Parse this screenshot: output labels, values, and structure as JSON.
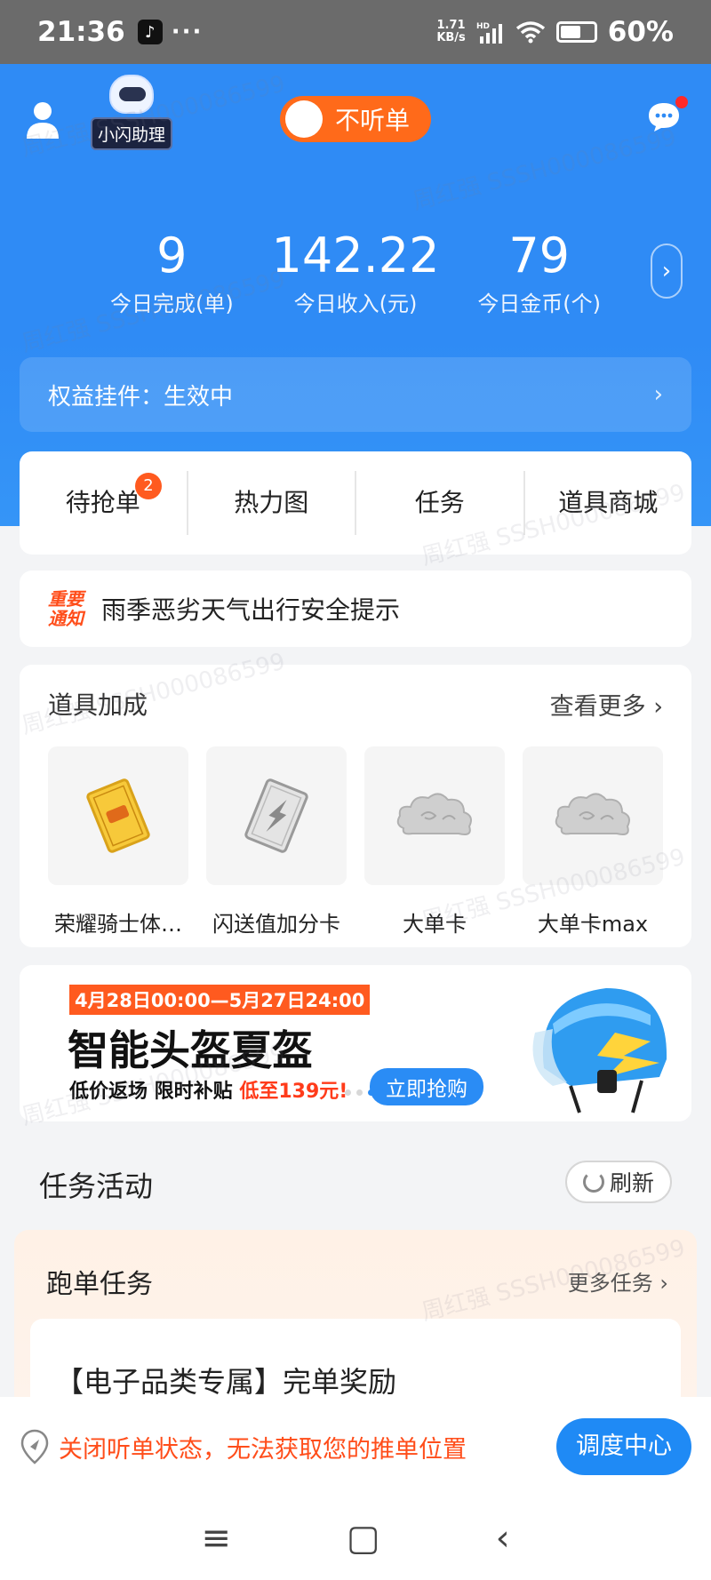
{
  "status_bar": {
    "time": "21:36",
    "dots": "···",
    "net_speed_top": "1.71",
    "net_speed_unit": "KB/s",
    "hd": "HD",
    "battery": "60%"
  },
  "header": {
    "assistant_label": "小闪助理",
    "listen_toggle_label": "不听单"
  },
  "stats": [
    {
      "value": "9",
      "label": "今日完成(单)"
    },
    {
      "value": "142.22",
      "label": "今日收入(元)"
    },
    {
      "value": "79",
      "label": "今日金币(个)"
    }
  ],
  "rights_bar": {
    "label": "权益挂件：生效中"
  },
  "nav": [
    {
      "label": "待抢单",
      "badge": "2"
    },
    {
      "label": "热力图"
    },
    {
      "label": "任务"
    },
    {
      "label": "道具商城"
    }
  ],
  "notice": {
    "tag_line1": "重要",
    "tag_line2": "通知",
    "text": "雨季恶劣天气出行安全提示"
  },
  "props": {
    "title": "道具加成",
    "more": "查看更多",
    "items": [
      {
        "name": "荣耀骑士体…",
        "icon": "gold-card-icon"
      },
      {
        "name": "闪送值加分卡",
        "icon": "lightning-card-icon"
      },
      {
        "name": "大单卡",
        "icon": "cloud-icon"
      },
      {
        "name": "大单卡max",
        "icon": "cloud-icon"
      }
    ]
  },
  "banner": {
    "date": "4月28日00:00—5月27日24:00",
    "title": "智能头盔夏盔",
    "sub_prefix": "低价返场 限时补贴 ",
    "price": "低至139元!",
    "button": "立即抢购"
  },
  "tasks_section": {
    "title": "任务活动",
    "refresh": "刷新",
    "card_title": "跑单任务",
    "card_more": "更多任务",
    "item_title": "【电子品类专属】完单奖励"
  },
  "bottom_bar": {
    "message": "关闭听单状态，无法获取您的推单位置",
    "button": "调度中心"
  },
  "watermark": "周红强 SSSH000086599",
  "colors": {
    "brand_blue": "#2f8bf5",
    "accent_orange": "#ff6a1a"
  }
}
